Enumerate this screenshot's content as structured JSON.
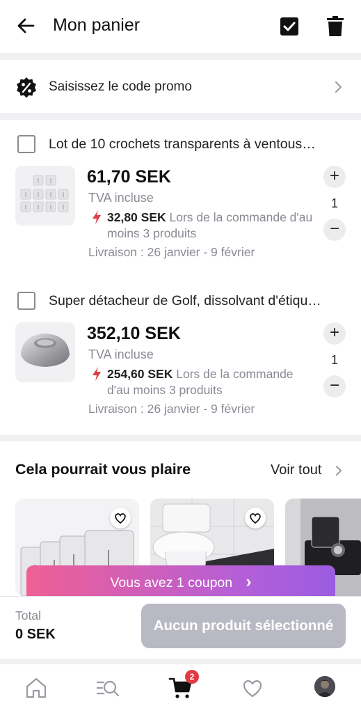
{
  "header": {
    "title": "Mon panier"
  },
  "promo": {
    "label": "Saisissez le code promo"
  },
  "items": [
    {
      "title": "Lot de 10 crochets transparents à ventous…",
      "price": "61,70 SEK",
      "tax": "TVA incluse",
      "deal_price": "32,80 SEK",
      "deal_text": "Lors de la commande d'au moins 3 produits",
      "delivery": "Livraison : 26 janvier - 9 février",
      "quantity": "1"
    },
    {
      "title": "Super détacheur de Golf, dissolvant d'étiqu…",
      "price": "352,10 SEK",
      "tax": "TVA incluse",
      "deal_price": "254,60 SEK",
      "deal_text": "Lors de la commande d'au moins 3 produits",
      "delivery": "Livraison : 26 janvier - 9 février",
      "quantity": "1"
    }
  ],
  "recommendations": {
    "title": "Cela pourrait vous plaire",
    "see_all": "Voir tout"
  },
  "coupon": {
    "label": "Vous avez 1 coupon",
    "chevron": "›"
  },
  "footer": {
    "total_label": "Total",
    "total_value": "0 SEK",
    "checkout_label": "Aucun produit sélectionné"
  },
  "nav": {
    "cart_badge": "2"
  },
  "colors": {
    "accent_red": "#e33b45",
    "coupon_start": "#ef5f95",
    "coupon_end": "#9b5ce0",
    "disabled_button": "#b9b9c4"
  },
  "icons": [
    "back-arrow-icon",
    "checkbox-checked-icon",
    "trash-icon",
    "promo-percent-icon",
    "chevron-right-icon",
    "bolt-icon",
    "heart-icon",
    "home-icon",
    "search-list-icon",
    "cart-icon",
    "favorites-icon",
    "avatar"
  ]
}
